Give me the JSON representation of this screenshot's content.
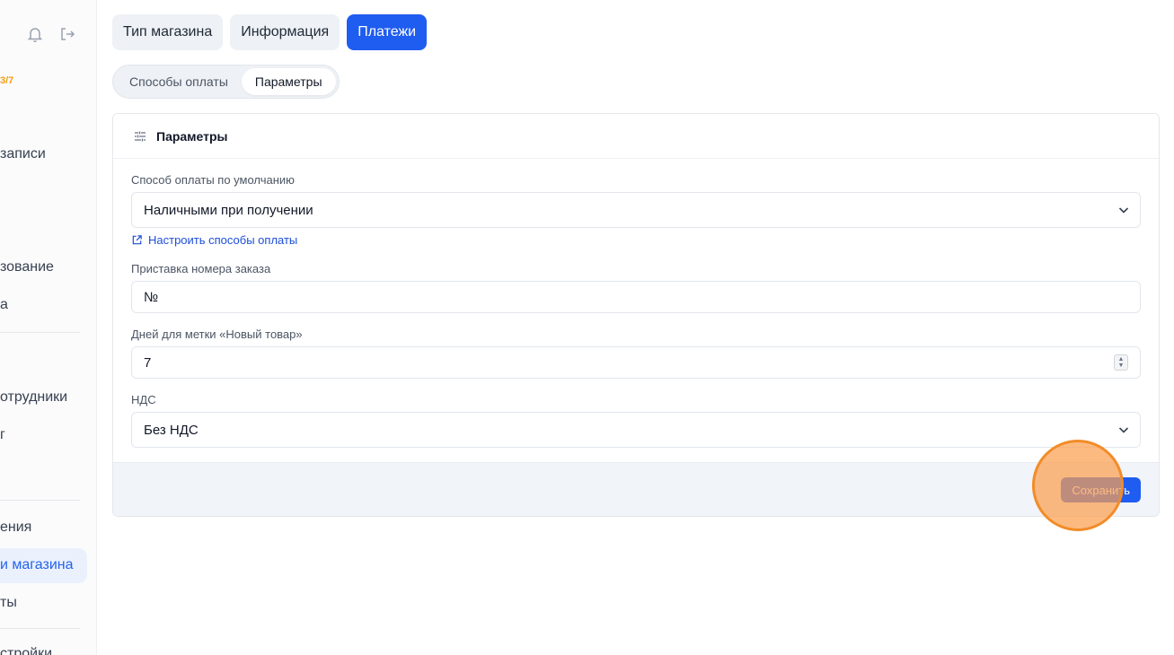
{
  "sidebar": {
    "badge": "3/7",
    "items": [
      {
        "label": "записи",
        "active": false
      },
      {
        "label": "зование",
        "active": false
      },
      {
        "label": "а",
        "active": false
      },
      {
        "label": "отрудники",
        "active": false
      },
      {
        "label": "г",
        "active": false
      },
      {
        "label": "ения",
        "active": false
      },
      {
        "label": "и магазина",
        "active": true
      },
      {
        "label": "ты",
        "active": false
      },
      {
        "label": "стройки",
        "active": false
      }
    ]
  },
  "tabs": [
    {
      "label": "Тип магазина",
      "active": false
    },
    {
      "label": "Информация",
      "active": false
    },
    {
      "label": "Платежи",
      "active": true
    }
  ],
  "subtabs": [
    {
      "label": "Способы оплаты",
      "active": false
    },
    {
      "label": "Параметры",
      "active": true
    }
  ],
  "card": {
    "title": "Параметры",
    "payment_label": "Способ оплаты по умолчанию",
    "payment_value": "Наличными при получении",
    "configure_link": "Настроить способы оплаты",
    "prefix_label": "Приставка номера заказа",
    "prefix_value": "№",
    "days_label": "Дней для метки «Новый товар»",
    "days_value": "7",
    "vat_label": "НДС",
    "vat_value": "Без НДС",
    "save_label": "Сохранить"
  },
  "icons": {
    "bell": "bell-icon",
    "logout": "logout-icon",
    "settings": "sliders-icon",
    "external_link": "external-link-icon",
    "chevron": "chevron-down-icon"
  },
  "colors": {
    "accent": "#1f5cf0",
    "badge": "#f59e0b",
    "highlight": "#f28c28"
  }
}
